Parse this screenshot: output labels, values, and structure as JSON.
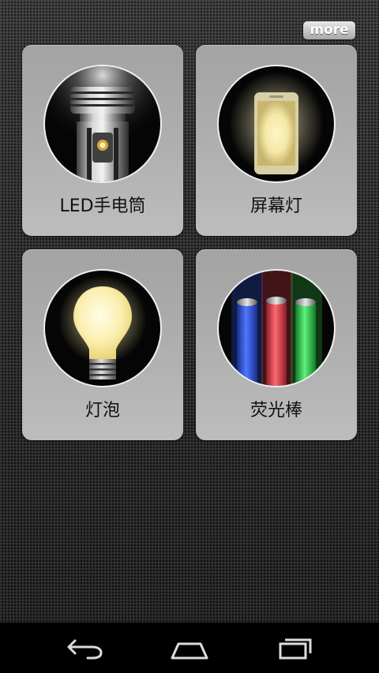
{
  "header": {
    "more_label": "more"
  },
  "tiles": [
    {
      "label": "LED手电筒",
      "icon": "flashlight-icon"
    },
    {
      "label": "屏幕灯",
      "icon": "screen-light-icon"
    },
    {
      "label": "灯泡",
      "icon": "light-bulb-icon"
    },
    {
      "label": "荧光棒",
      "icon": "glow-sticks-icon"
    }
  ],
  "navbar": {
    "back": "back-icon",
    "home": "home-icon",
    "recent": "recent-apps-icon"
  },
  "colors": {
    "tile_background": "#adadad",
    "glow_yellow": "#fff3b0",
    "glow_stick_blue": "#2f55e0",
    "glow_stick_red": "#e04048",
    "glow_stick_green": "#2fc048"
  }
}
